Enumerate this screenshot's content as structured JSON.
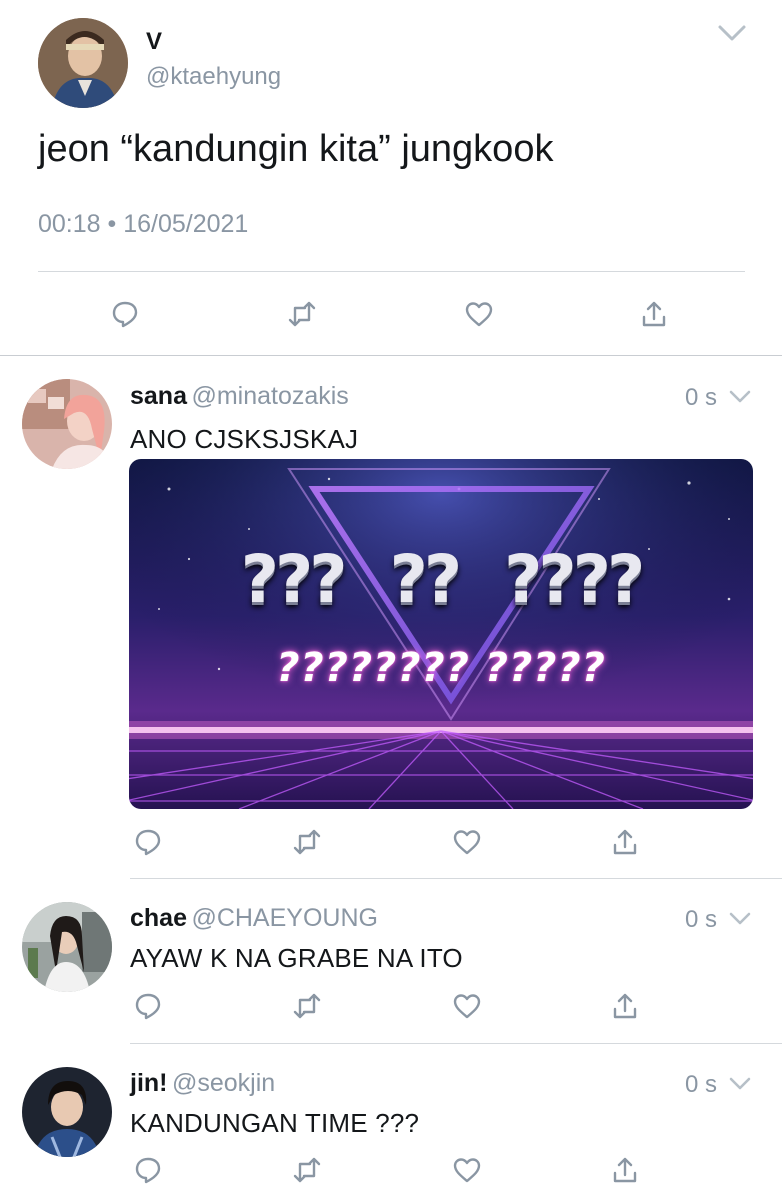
{
  "colors": {
    "muted": "#8a96a3",
    "divider": "#d5d9dd",
    "text": "#14171a"
  },
  "main_tweet": {
    "name": "V",
    "handle": "@ktaehyung",
    "text": "jeon “kandungin kita” jungkook",
    "timestamp": "00:18 • 16/05/2021",
    "icons": [
      "reply-icon",
      "retweet-icon",
      "like-icon",
      "share-icon"
    ]
  },
  "replies": [
    {
      "name": "sana",
      "handle": "@minatozakis",
      "time": "0 s",
      "text": "ANO CJSKSJSKAJ",
      "image": {
        "big_marks": [
          "???",
          "??",
          "????"
        ],
        "small_marks": "???????? ?????"
      }
    },
    {
      "name": "chae",
      "handle": "@CHAEYOUNG",
      "time": "0 s",
      "text": "AYAW K NA GRABE NA ITO"
    },
    {
      "name": "jin!",
      "handle": "@seokjin",
      "time": "0 s",
      "text": "KANDUNGAN TIME ???"
    }
  ]
}
